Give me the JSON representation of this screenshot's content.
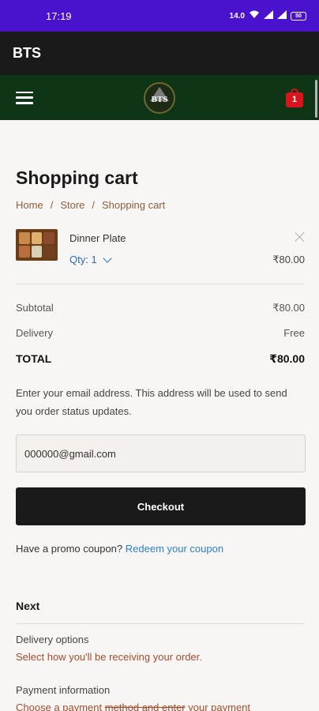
{
  "status_bar": {
    "time": "17:19",
    "network": "14.0 KB/S",
    "battery": "50"
  },
  "app_bar": {
    "title": "BTS"
  },
  "header": {
    "logo_text": "BTS",
    "cart_count": "1"
  },
  "page": {
    "title": "Shopping cart",
    "breadcrumb": [
      "Home",
      "Store",
      "Shopping cart"
    ]
  },
  "cart_item": {
    "name": "Dinner Plate",
    "qty_label": "Qty: 1",
    "price": "₹80.00"
  },
  "summary": {
    "subtotal_label": "Subtotal",
    "subtotal_value": "₹80.00",
    "delivery_label": "Delivery",
    "delivery_value": "Free",
    "total_label": "TOTAL",
    "total_value": "₹80.00"
  },
  "email": {
    "note": "Enter your email address. This address will be used to send you order status updates.",
    "value": "000000@gmail.com"
  },
  "checkout_label": "Checkout",
  "promo": {
    "text": "Have a promo coupon?",
    "link": "Redeem your coupon"
  },
  "next": {
    "heading": "Next",
    "steps": [
      {
        "title": "Delivery options",
        "desc": "Select how you'll be receiving your order."
      },
      {
        "title": "Payment information",
        "desc_pre": "Choose a payment ",
        "desc_strike": "method and enter",
        "desc_post": " your payment"
      }
    ]
  },
  "colors": {
    "status_bar": "#4a12cc",
    "app_bar": "#1a1a1a",
    "header": "#0d3516",
    "cart": "#d8151f",
    "link": "#2b7fc3",
    "accent": "#a14d2e"
  }
}
